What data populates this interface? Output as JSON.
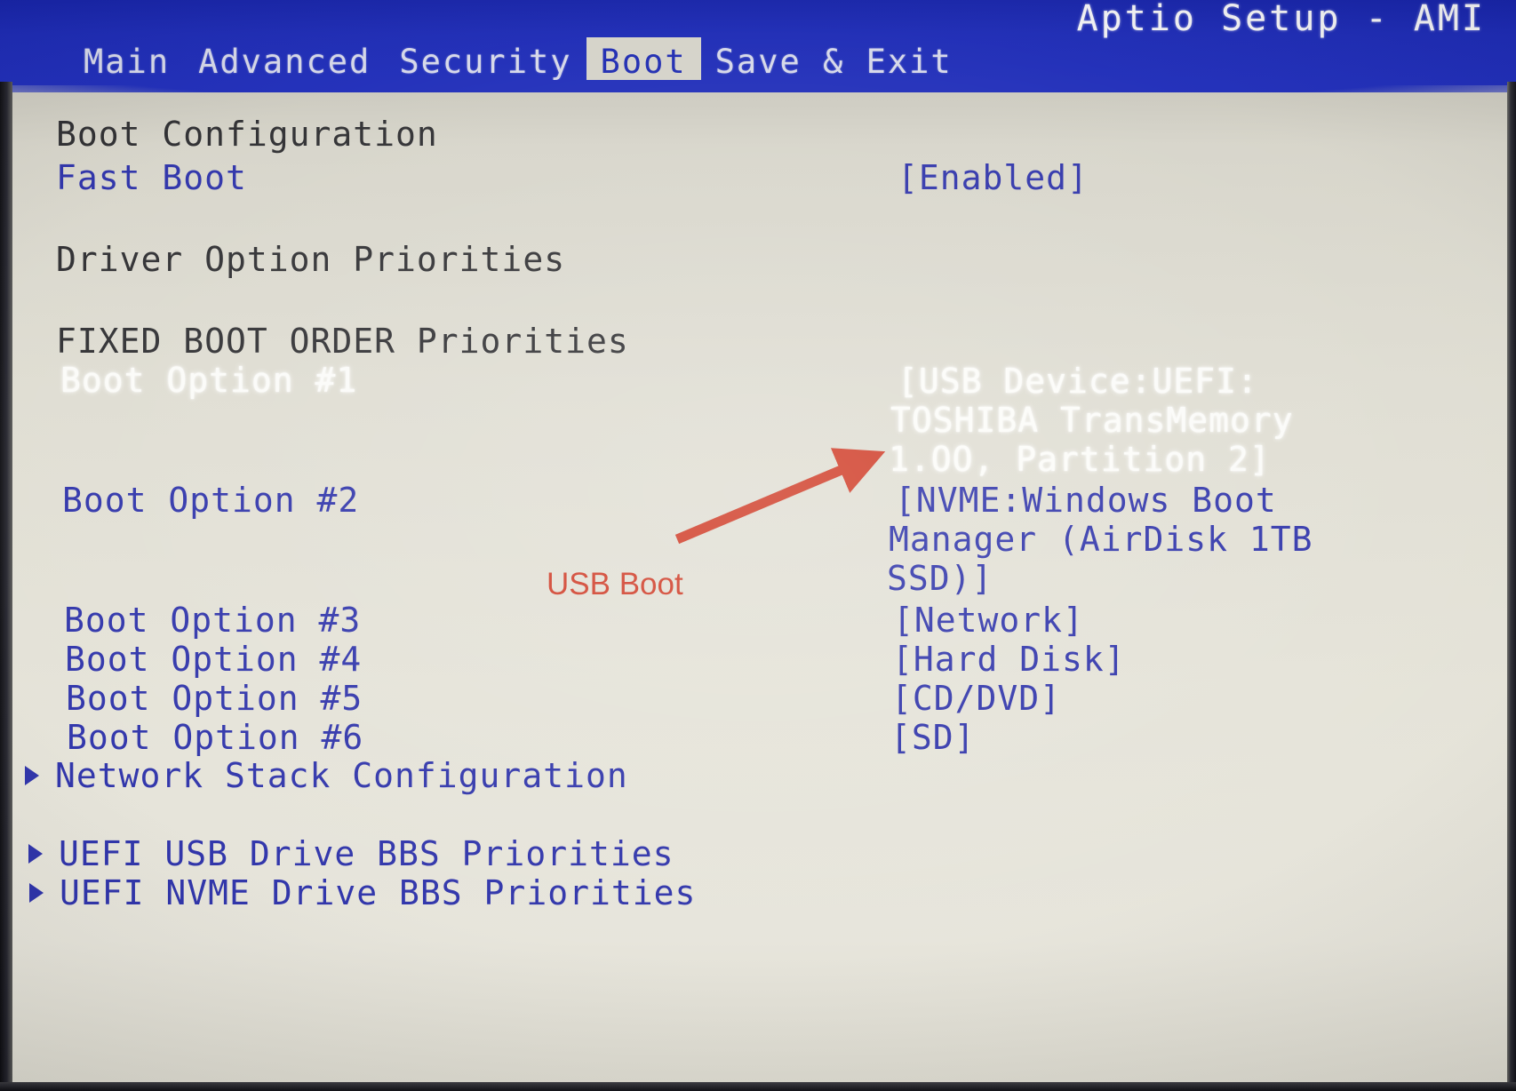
{
  "header": {
    "app_title": "Aptio Setup - AMI",
    "tabs": [
      {
        "label": "Main",
        "selected": false
      },
      {
        "label": "Advanced",
        "selected": false
      },
      {
        "label": "Security",
        "selected": false
      },
      {
        "label": "Boot",
        "selected": true
      },
      {
        "label": "Save & Exit",
        "selected": false
      }
    ]
  },
  "main": {
    "section_boot_config": "Boot Configuration",
    "fast_boot_label": "Fast Boot",
    "fast_boot_value": "[Enabled]",
    "section_driver_option_priorities": "Driver Option Priorities",
    "section_fixed_boot_order": "FIXED BOOT ORDER Priorities",
    "boot_options": [
      {
        "label": "Boot Option #1",
        "selected": true
      },
      {
        "label": "Boot Option #2",
        "selected": false
      },
      {
        "label": "Boot Option #3",
        "selected": false
      },
      {
        "label": "Boot Option #4",
        "selected": false
      },
      {
        "label": "Boot Option #5",
        "selected": false
      },
      {
        "label": "Boot Option #6",
        "selected": false
      }
    ],
    "boot_values": {
      "opt1_line1": "[USB Device:UEFI:",
      "opt1_line2": "TOSHIBA TransMemory",
      "opt1_line3": "1.OO, Partition 2]",
      "opt2_line1": "[NVME:Windows Boot",
      "opt2_line2": "Manager (AirDisk 1TB",
      "opt2_line3": "SSD)]",
      "opt3": "[Network]",
      "opt4": "[Hard Disk]",
      "opt5": "[CD/DVD]",
      "opt6": "[SD]"
    },
    "submenus": [
      {
        "label": "Network Stack Configuration"
      },
      {
        "label": "UEFI USB Drive BBS Priorities"
      },
      {
        "label": "UEFI NVME Drive BBS Priorities"
      }
    ]
  },
  "annotation": {
    "label": "USB Boot",
    "color": "#cf3a25"
  },
  "colors": {
    "header_blue": "#1c2ab8",
    "text_blue": "#2a2fa8",
    "heading_dark": "#2b2b2e",
    "screen_bg": "#e2e0d5",
    "selected_tab_bg": "#d4d2c8",
    "highlight_white": "#fbfbf8"
  }
}
